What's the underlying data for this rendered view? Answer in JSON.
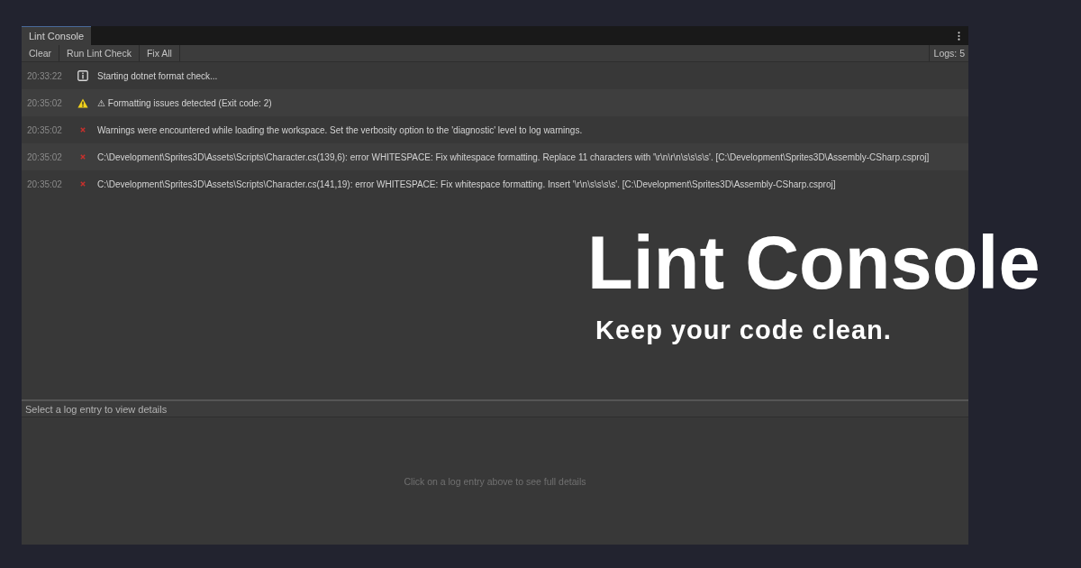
{
  "window": {
    "tab": {
      "label": "Lint Console",
      "selected": true
    }
  },
  "toolbar": {
    "buttons": [
      "Clear",
      "Run Lint Check",
      "Fix All"
    ],
    "log_count": "Logs: 5"
  },
  "logs": [
    {
      "time": "20:33:22",
      "kind": "info",
      "message": "Starting dotnet format check..."
    },
    {
      "time": "20:35:02",
      "kind": "warning",
      "message": "⚠ Formatting issues detected (Exit code: 2)"
    },
    {
      "time": "20:35:02",
      "kind": "error",
      "message": "Warnings were encountered while loading the workspace. Set the verbosity option to the 'diagnostic' level to log warnings."
    },
    {
      "time": "20:35:02",
      "kind": "error",
      "message": "C:\\Development\\Sprites3D\\Assets\\Scripts\\Character.cs(139,6): error WHITESPACE: Fix whitespace formatting. Replace 11 characters with '\\r\\n\\r\\n\\s\\s\\s\\s'. [C:\\Development\\Sprites3D\\Assembly-CSharp.csproj]"
    },
    {
      "time": "20:35:02",
      "kind": "error",
      "message": "C:\\Development\\Sprites3D\\Assets\\Scripts\\Character.cs(141,19): error WHITESPACE: Fix whitespace formatting. Insert '\\r\\n\\s\\s\\s\\s'. [C:\\Development\\Sprites3D\\Assembly-CSharp.csproj]"
    }
  ],
  "details": {
    "header": "Select a log entry to view details",
    "empty_message": "Click on a log entry above to see full details"
  },
  "banner": {
    "title": "Lint Console",
    "tagline": "Keep your code clean."
  }
}
